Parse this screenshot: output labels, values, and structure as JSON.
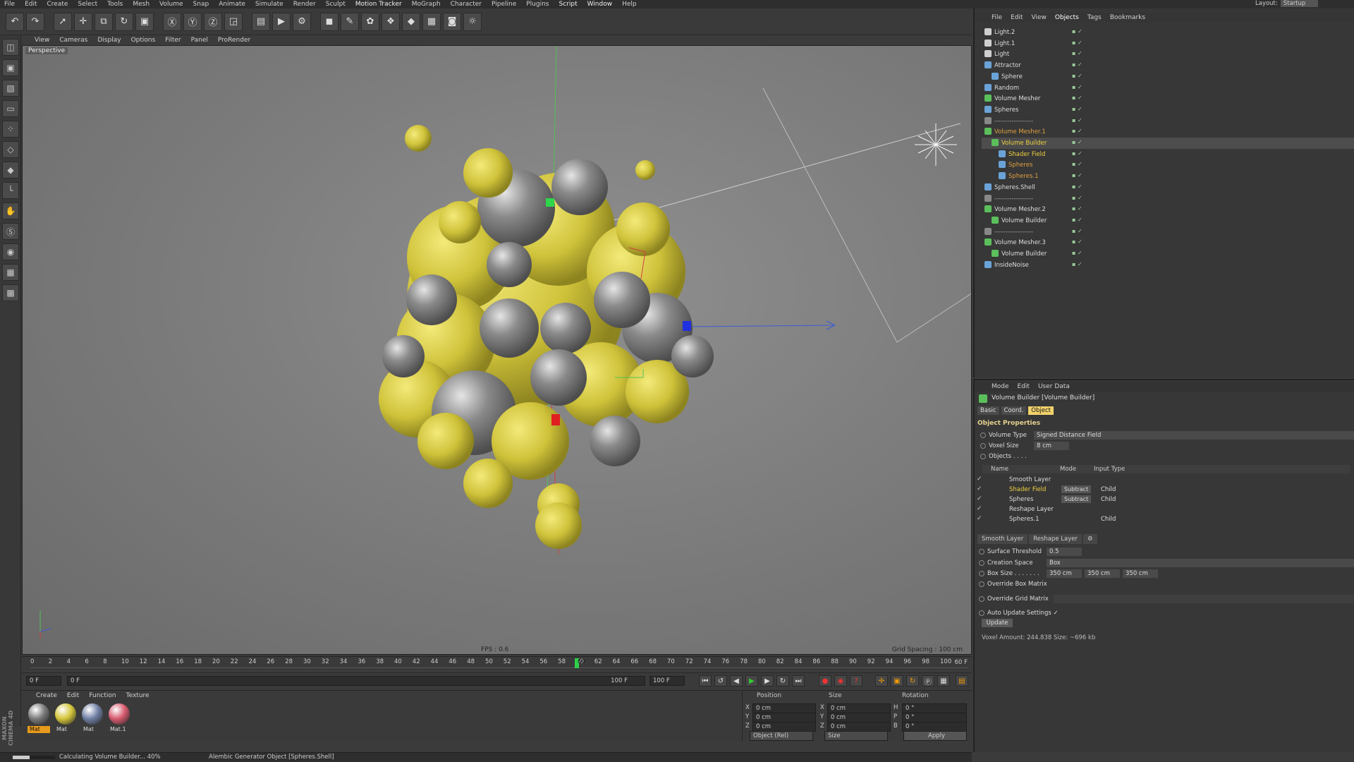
{
  "menubar": [
    "File",
    "Edit",
    "Create",
    "Select",
    "Tools",
    "Mesh",
    "Volume",
    "Snap",
    "Animate",
    "Simulate",
    "Render",
    "Sculpt",
    "Motion Tracker",
    "MoGraph",
    "Character",
    "Pipeline",
    "Plugins",
    "Script",
    "Window",
    "Help"
  ],
  "layout": {
    "label": "Layout:",
    "value": "Startup"
  },
  "viewport": {
    "menu": [
      "View",
      "Cameras",
      "Display",
      "Options",
      "Filter",
      "Panel",
      "ProRender"
    ],
    "label": "Perspective",
    "fps": "FPS : 0.6",
    "grid": "Grid Spacing : 100 cm"
  },
  "timeline": {
    "ticks": [
      "0",
      "2",
      "4",
      "6",
      "8",
      "10",
      "12",
      "14",
      "16",
      "18",
      "20",
      "22",
      "24",
      "26",
      "28",
      "30",
      "32",
      "34",
      "36",
      "38",
      "40",
      "42",
      "44",
      "46",
      "48",
      "50",
      "52",
      "54",
      "56",
      "58",
      "60",
      "62",
      "64",
      "66",
      "68",
      "70",
      "72",
      "74",
      "76",
      "78",
      "80",
      "82",
      "84",
      "86",
      "88",
      "90",
      "92",
      "94",
      "96",
      "98",
      "100"
    ],
    "current": "60",
    "end": "60 F"
  },
  "transport": {
    "start": "0 F",
    "range_start": "0 F",
    "range_end": "100 F",
    "end": "100 F"
  },
  "material_manager": {
    "menu": [
      "Create",
      "Edit",
      "Function",
      "Texture"
    ],
    "materials": [
      {
        "label": "Mat",
        "color": "#7a7a7a"
      },
      {
        "label": "Mat",
        "color": "#d4c53a"
      },
      {
        "label": "Mat",
        "color": "#6f7fa3"
      },
      {
        "label": "Mat.1",
        "color": "#d65a6e"
      }
    ]
  },
  "coordinates": {
    "headers": [
      "Position",
      "Size",
      "Rotation"
    ],
    "rows": [
      {
        "a": "X",
        "pos": "0 cm",
        "b": "X",
        "size": "0 cm",
        "c": "H",
        "rot": "0 °"
      },
      {
        "a": "Y",
        "pos": "0 cm",
        "b": "Y",
        "size": "0 cm",
        "c": "P",
        "rot": "0 °"
      },
      {
        "a": "Z",
        "pos": "0 cm",
        "b": "Z",
        "size": "0 cm",
        "c": "B",
        "rot": "0 °"
      }
    ],
    "mode": "Object (Rel)",
    "size_mode": "Size",
    "apply": "Apply"
  },
  "status": {
    "progress_text": "Calculating Volume Builder... 40%",
    "progress": 0.4,
    "info": "Alembic Generator Object [Spheres.Shell]"
  },
  "object_manager": {
    "menu": [
      "File",
      "Edit",
      "View",
      "Objects",
      "Tags",
      "Bookmarks"
    ],
    "rows": [
      {
        "name": "Light.2",
        "indent": 0,
        "color": "#ddd",
        "icon": "#cfcfcf"
      },
      {
        "name": "Light.1",
        "indent": 0,
        "color": "#ddd",
        "icon": "#cfcfcf"
      },
      {
        "name": "Light",
        "indent": 0,
        "color": "#ddd",
        "icon": "#cfcfcf"
      },
      {
        "name": "Attractor",
        "indent": 0,
        "color": "#ddd",
        "icon": "#6aa3d8"
      },
      {
        "name": "Sphere",
        "indent": 1,
        "color": "#ddd",
        "icon": "#6aa3d8"
      },
      {
        "name": "Random",
        "indent": 0,
        "color": "#ddd",
        "icon": "#6aa3d8"
      },
      {
        "name": "Volume Mesher",
        "indent": 0,
        "color": "#ddd",
        "icon": "#5bbf5b"
      },
      {
        "name": "Spheres",
        "indent": 0,
        "color": "#ddd",
        "icon": "#6aa3d8"
      },
      {
        "name": "------------------",
        "indent": 0,
        "color": "#aaa",
        "icon": "#888"
      },
      {
        "name": "Volume Mesher.1",
        "indent": 0,
        "color": "#e0a040",
        "icon": "#5bbf5b"
      },
      {
        "name": "Volume Builder",
        "indent": 1,
        "color": "#f0d040",
        "icon": "#5bbf5b"
      },
      {
        "name": "Shader Field",
        "indent": 2,
        "color": "#f0d040",
        "icon": "#6aa3d8"
      },
      {
        "name": "Spheres",
        "indent": 2,
        "color": "#e0a040",
        "icon": "#6aa3d8"
      },
      {
        "name": "Spheres.1",
        "indent": 2,
        "color": "#e0a040",
        "icon": "#6aa3d8"
      },
      {
        "name": "Spheres.Shell",
        "indent": 0,
        "color": "#ddd",
        "icon": "#6aa3d8"
      },
      {
        "name": "------------------",
        "indent": 0,
        "color": "#aaa",
        "icon": "#888"
      },
      {
        "name": "Volume Mesher.2",
        "indent": 0,
        "color": "#ddd",
        "icon": "#5bbf5b"
      },
      {
        "name": "Volume Builder",
        "indent": 1,
        "color": "#ddd",
        "icon": "#5bbf5b"
      },
      {
        "name": "------------------",
        "indent": 0,
        "color": "#aaa",
        "icon": "#888"
      },
      {
        "name": "Volume Mesher.3",
        "indent": 0,
        "color": "#ddd",
        "icon": "#5bbf5b"
      },
      {
        "name": "Volume Builder",
        "indent": 1,
        "color": "#ddd",
        "icon": "#5bbf5b"
      },
      {
        "name": "InsideNoise",
        "indent": 0,
        "color": "#ddd",
        "icon": "#6aa3d8"
      }
    ]
  },
  "attributes": {
    "menu": [
      "Mode",
      "Edit",
      "User Data"
    ],
    "title": "Volume Builder [Volume Builder]",
    "tabs": [
      "Basic",
      "Coord.",
      "Object"
    ],
    "section": "Object Properties",
    "volume_type_label": "Volume Type",
    "volume_type": "Signed Distance Field",
    "voxel_size_label": "Voxel Size",
    "voxel_size": "8 cm",
    "objects_label": "Objects . . . .",
    "list_headers": [
      "Name",
      "Mode",
      "Input Type"
    ],
    "list": [
      {
        "name": "Smooth Layer",
        "mode": "",
        "input": "",
        "color": "#ddd"
      },
      {
        "name": "Shader Field",
        "mode": "Subtract",
        "input": "Child",
        "color": "#f0d040"
      },
      {
        "name": "Spheres",
        "mode": "Subtract",
        "input": "Child",
        "color": "#ddd"
      },
      {
        "name": "Reshape Layer",
        "mode": "",
        "input": "",
        "color": "#ddd"
      },
      {
        "name": "Spheres.1",
        "mode": "",
        "input": "Child",
        "color": "#ddd"
      }
    ],
    "layer_tabs": [
      "Smooth Layer",
      "Reshape Layer"
    ],
    "surface_threshold_label": "Surface Threshold",
    "surface_threshold": "0.5",
    "creation_space_label": "Creation Space",
    "creation_space": "Box",
    "box_size_label": "Box Size . . . . . . .",
    "box_size": [
      "350 cm",
      "350 cm",
      "350 cm"
    ],
    "override_box_label": "Override Box Matrix",
    "override_grid_label": "Override Grid Matrix",
    "auto_update_label": "Auto Update Settings ✓",
    "update_button": "Update",
    "voxel_amount": "Voxel Amount: 244.838   Size: ~696 kb"
  },
  "logo": "MAXON CINEMA 4D"
}
